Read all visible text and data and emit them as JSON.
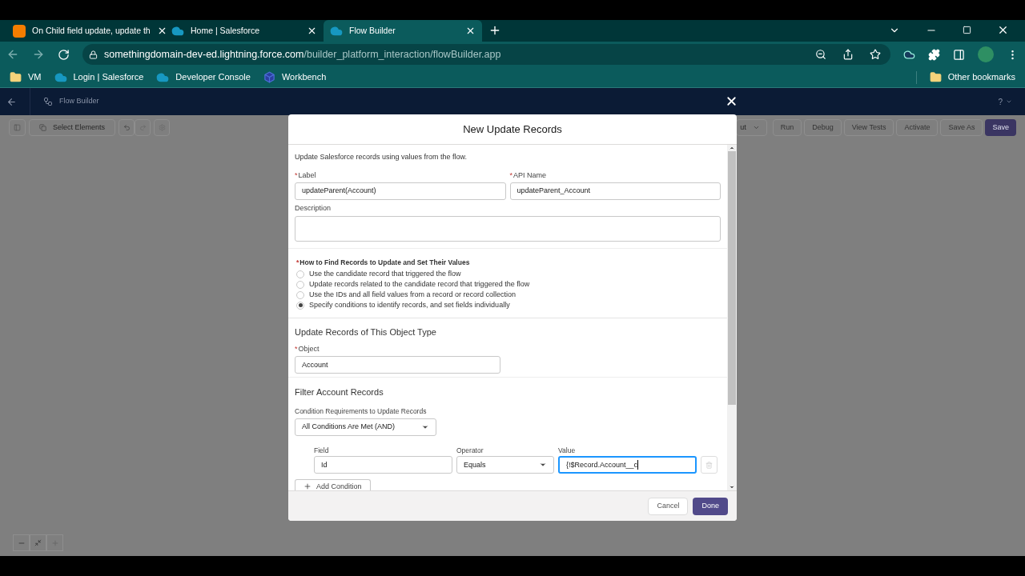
{
  "browser": {
    "tabs": [
      {
        "title": "On Child field update, update th",
        "kind": "blog",
        "selected": false
      },
      {
        "title": "Home | Salesforce",
        "kind": "cloud",
        "selected": false
      },
      {
        "title": "Flow Builder",
        "kind": "cloud",
        "selected": true
      }
    ],
    "url": {
      "domain": "somethingdomain-dev-ed.lightning.force.com",
      "path": "/builder_platform_interaction/flowBuilder.app"
    },
    "bookmarks": [
      {
        "label": "VM",
        "kind": "folder"
      },
      {
        "label": "Login | Salesforce",
        "kind": "cloud"
      },
      {
        "label": "Developer Console",
        "kind": "cloud"
      },
      {
        "label": "Workbench",
        "kind": "cube"
      }
    ],
    "other_bookmarks": "Other bookmarks"
  },
  "app_header": {
    "title": "Flow Builder",
    "help": "?"
  },
  "toolbar": {
    "select_elements": "Select Elements",
    "partial_label": "ut",
    "buttons": [
      {
        "label": "Run",
        "primary": false
      },
      {
        "label": "Debug",
        "primary": false
      },
      {
        "label": "View Tests",
        "primary": false
      },
      {
        "label": "Activate",
        "primary": false
      },
      {
        "label": "Save As",
        "primary": false
      },
      {
        "label": "Save",
        "primary": true
      }
    ]
  },
  "modal": {
    "title": "New Update Records",
    "intro": "Update Salesforce records using values from the flow.",
    "label_field": {
      "mark": "*",
      "label": "Label",
      "value": "updateParent(Account)"
    },
    "api_field": {
      "mark": "*",
      "label": "API Name",
      "value": "updateParent_Account"
    },
    "description_field": {
      "label": "Description"
    },
    "how_to": {
      "mark": "*",
      "label": "How to Find Records to Update and Set Their Values",
      "options": [
        {
          "label": "Use the candidate record that triggered the flow",
          "selected": false
        },
        {
          "label": "Update records related to the candidate record that triggered the flow",
          "selected": false
        },
        {
          "label": "Use the IDs and all field values from a record or record collection",
          "selected": false
        },
        {
          "label": "Specify conditions to identify records, and set fields individually",
          "selected": true
        }
      ]
    },
    "object_section": {
      "heading": "Update Records of This Object Type",
      "mark": "*",
      "label": "Object",
      "value": "Account"
    },
    "filter": {
      "heading": "Filter Account Records",
      "requirement_label": "Condition Requirements to Update Records",
      "requirement_value": "All Conditions Are Met (AND)",
      "condition": {
        "field_label": "Field",
        "field_value": "Id",
        "operator_label": "Operator",
        "operator_value": "Equals",
        "value_label": "Value",
        "value_value": "{!$Record.Account__c"
      },
      "add_condition": "Add Condition"
    },
    "cancel": "Cancel",
    "done": "Done"
  }
}
